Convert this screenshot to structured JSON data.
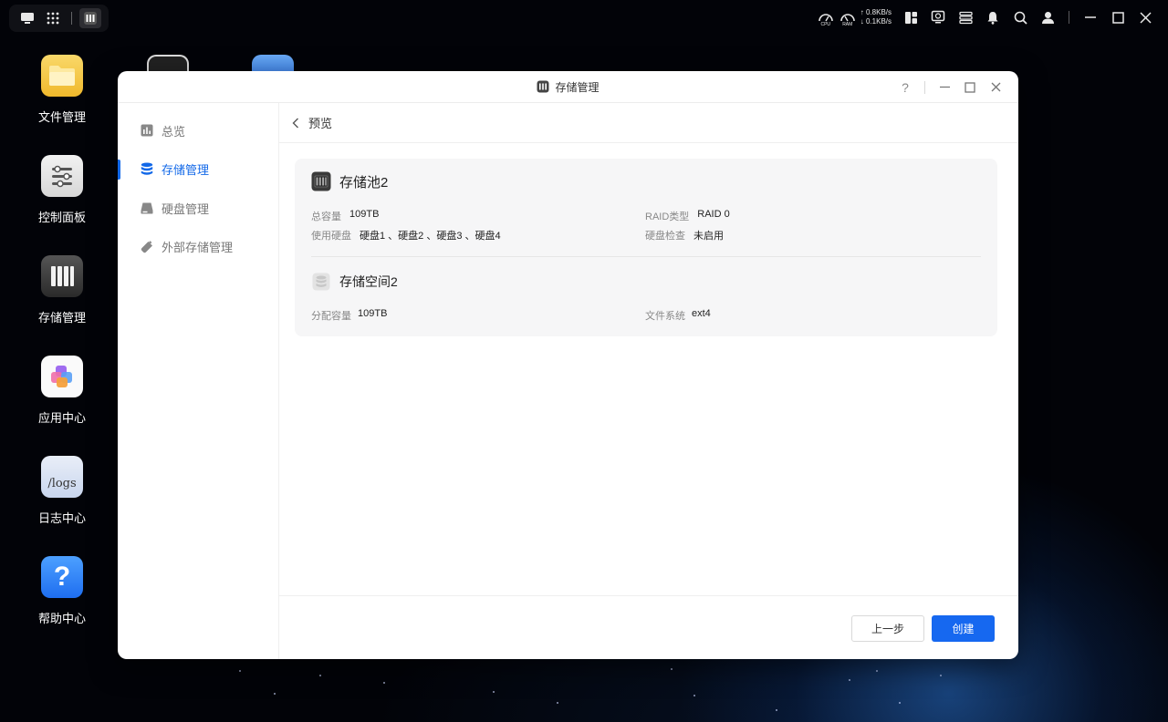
{
  "topbar": {
    "left_icons": [
      "desktop-icon",
      "app-grid-icon",
      "storage-app-icon"
    ],
    "cpu_label": "CPU",
    "ram_label": "RAM",
    "net_up": "0.8KB/s",
    "net_down": "0.1KB/s",
    "right_icons": [
      "widgets-icon",
      "monitor-icon",
      "tasks-icon",
      "bell-icon",
      "search-icon",
      "user-icon",
      "minimize-icon",
      "maximize-icon",
      "close-icon"
    ]
  },
  "desktop": {
    "icons": [
      {
        "label": "文件管理",
        "icon": "folder-icon"
      },
      {
        "label": "控制面板",
        "icon": "control-panel-icon"
      },
      {
        "label": "存储管理",
        "icon": "storage-icon"
      },
      {
        "label": "应用中心",
        "icon": "app-center-icon"
      },
      {
        "label": "日志中心",
        "icon": "logs-icon",
        "tile_text": "/logs"
      },
      {
        "label": "帮助中心",
        "icon": "help-icon",
        "tile_text": "?"
      }
    ]
  },
  "window": {
    "title": "存储管理",
    "help": "?",
    "sidebar": [
      {
        "label": "总览",
        "icon": "overview-icon",
        "active": false
      },
      {
        "label": "存储管理",
        "icon": "database-icon",
        "active": true
      },
      {
        "label": "硬盘管理",
        "icon": "disk-icon",
        "active": false
      },
      {
        "label": "外部存储管理",
        "icon": "usb-drive-icon",
        "active": false
      }
    ],
    "breadcrumb": "预览",
    "pool": {
      "name": "存储池2",
      "total_capacity_label": "总容量",
      "total_capacity": "109TB",
      "raid_type_label": "RAID类型",
      "raid_type": "RAID 0",
      "disks_label": "使用硬盘",
      "disks": "硬盘1 、硬盘2 、硬盘3 、硬盘4",
      "disk_check_label": "硬盘检查",
      "disk_check": "未启用"
    },
    "space": {
      "name": "存储空间2",
      "allocated_label": "分配容量",
      "allocated": "109TB",
      "fs_label": "文件系统",
      "fs": "ext4"
    },
    "buttons": {
      "prev": "上一步",
      "create": "创建"
    }
  },
  "colors": {
    "accent": "#1668f0",
    "active_nav": "#1268e8"
  }
}
